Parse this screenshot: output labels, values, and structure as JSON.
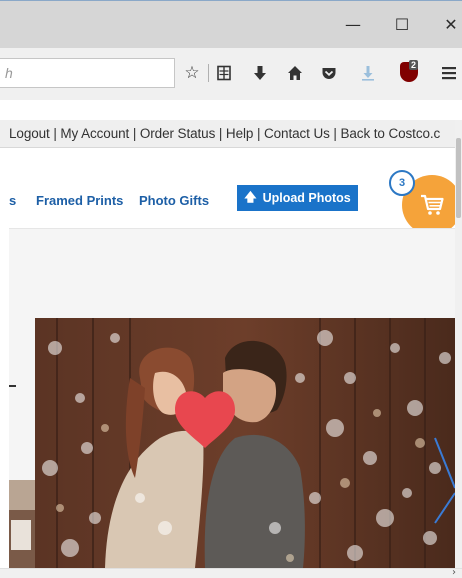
{
  "window": {
    "minimize_icon": "minimize-icon",
    "maximize_icon": "maximize-icon",
    "close_icon": "close-icon"
  },
  "urlbar": {
    "placeholder": "h"
  },
  "toolbar": {
    "icons": [
      "star-icon",
      "reading-list-icon",
      "download-arrow-icon",
      "home-icon",
      "pocket-icon",
      "downloads-icon",
      "ublock-icon",
      "hamburger-menu-icon"
    ],
    "ublock_badge": "2"
  },
  "account_links": {
    "text": "Logout | My Account | Order Status | Help | Contact Us | Back to Costco.c"
  },
  "category_nav": {
    "items": [
      "s",
      "Framed Prints",
      "Photo Gifts"
    ],
    "upload_label": "Upload Photos"
  },
  "cart": {
    "count": "3",
    "accent": "#f5a33a"
  },
  "colors": {
    "link": "#1d5fa6",
    "button": "#1a73c9"
  }
}
